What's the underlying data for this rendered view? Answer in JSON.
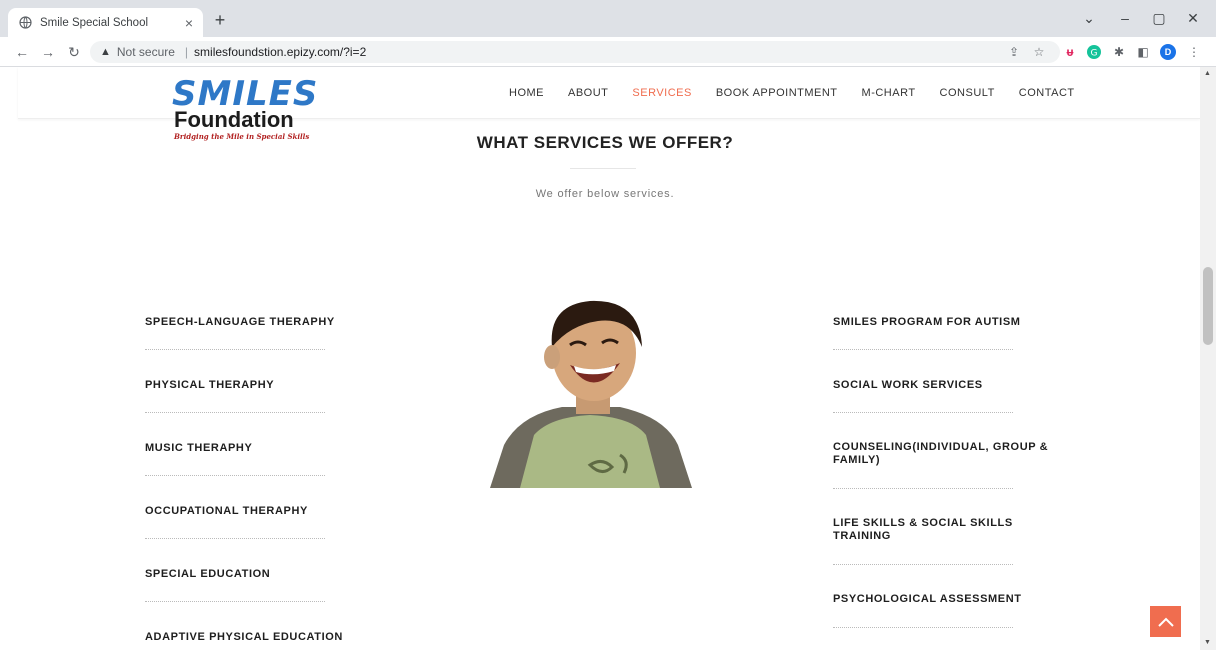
{
  "browser": {
    "tab_title": "Smile Special School",
    "tab_close": "×",
    "new_tab": "+",
    "not_secure": "Not secure",
    "url": "smilesfoundstion.epizy.com/?i=2",
    "profile_initial": "D"
  },
  "site": {
    "logo": {
      "line1": "SMILES",
      "line2": "Foundation",
      "tagline": "Bridging the Mile in Special Skills"
    },
    "nav": [
      "HOME",
      "ABOUT",
      "SERVICES",
      "BOOK APPOINTMENT",
      "M-CHART",
      "CONSULT",
      "CONTACT"
    ],
    "active_nav": "SERVICES",
    "section_title": "WHAT SERVICES WE OFFER?",
    "section_subtitle": "We offer below services.",
    "left_services": [
      "SPEECH-LANGUAGE THERAPHY",
      "PHYSICAL THERAPHY",
      "MUSIC THERAPHY",
      "OCCUPATIONAL THERAPHY",
      "SPECIAL EDUCATION",
      "ADAPTIVE PHYSICAL EDUCATION"
    ],
    "right_services": [
      "SMILES PROGRAM FOR AUTISM",
      "SOCIAL WORK SERVICES",
      "COUNSELING(INDIVIDUAL, GROUP & FAMILY)",
      "LIFE SKILLS & SOCIAL SKILLS TRAINING",
      "PSYCHOLOGICAL ASSESSMENT"
    ]
  },
  "colors": {
    "accent": "#f06d4f",
    "logo_blue": "#2e78c7"
  }
}
